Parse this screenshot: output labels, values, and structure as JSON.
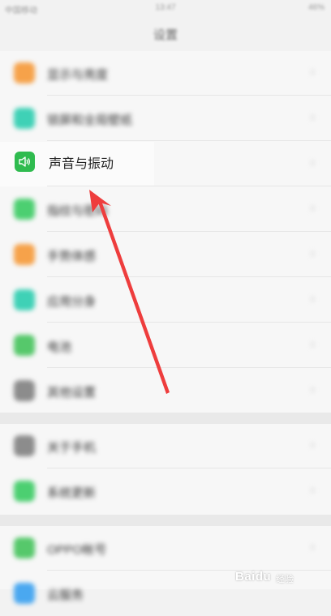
{
  "status_bar": {
    "carrier": "中国移动",
    "time": "13:47",
    "right": "46%"
  },
  "title": "设置",
  "settings": {
    "group1": [
      {
        "label": "显示与亮度",
        "icon": "display-icon",
        "color": "#f6a24a"
      },
      {
        "label": "锁屏和全局壁纸",
        "icon": "wallpaper-icon",
        "color": "#3fd1b6"
      },
      {
        "label": "声音与振动",
        "icon": "speaker-icon",
        "color": "#2fbb4f"
      },
      {
        "label": "指纹与密码",
        "icon": "fingerprint-icon",
        "color": "#4ccf71"
      },
      {
        "label": "手势体感",
        "icon": "gesture-icon",
        "color": "#f6a24a"
      },
      {
        "label": "应用分身",
        "icon": "clone-icon",
        "color": "#3fd1b6"
      },
      {
        "label": "电池",
        "icon": "battery-icon",
        "color": "#56c86b"
      },
      {
        "label": "其他设置",
        "icon": "more-icon",
        "color": "#8c8c8c"
      }
    ],
    "group2": [
      {
        "label": "关于手机",
        "icon": "phone-icon",
        "color": "#8c8c8c"
      },
      {
        "label": "系统更新",
        "icon": "update-icon",
        "color": "#4ccf71"
      }
    ],
    "group3": [
      {
        "label": "OPPO帐号",
        "icon": "account-icon",
        "color": "#56c86b"
      },
      {
        "label": "云服务",
        "icon": "cloud-icon",
        "color": "#4aa8f0"
      }
    ]
  },
  "highlight_label": "声音与振动",
  "arrow_color": "#ee3d3d",
  "watermark": {
    "brand": "Baidu",
    "sub": "经验"
  }
}
